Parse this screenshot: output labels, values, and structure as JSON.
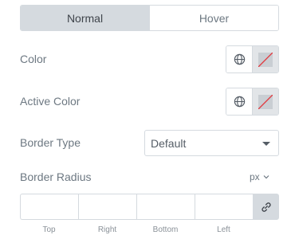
{
  "tabs": {
    "normal": "Normal",
    "hover": "Hover",
    "active": "normal"
  },
  "color": {
    "label": "Color"
  },
  "active_color": {
    "label": "Active Color"
  },
  "border_type": {
    "label": "Border Type",
    "value": "Default"
  },
  "border_radius": {
    "label": "Border Radius",
    "unit": "px",
    "inputs": {
      "top": "",
      "right": "",
      "bottom": "",
      "left": ""
    },
    "labels": {
      "top": "Top",
      "right": "Right",
      "bottom": "Bottom",
      "left": "Left"
    }
  },
  "colors": {
    "tab_active_bg": "#d5dadf",
    "border": "#d5dadf",
    "swatch_slash": "#e2343a"
  },
  "icons": {
    "global": "globe-icon",
    "unset": "no-color-icon",
    "dropdown": "caret-down-icon",
    "link": "link-icon"
  }
}
